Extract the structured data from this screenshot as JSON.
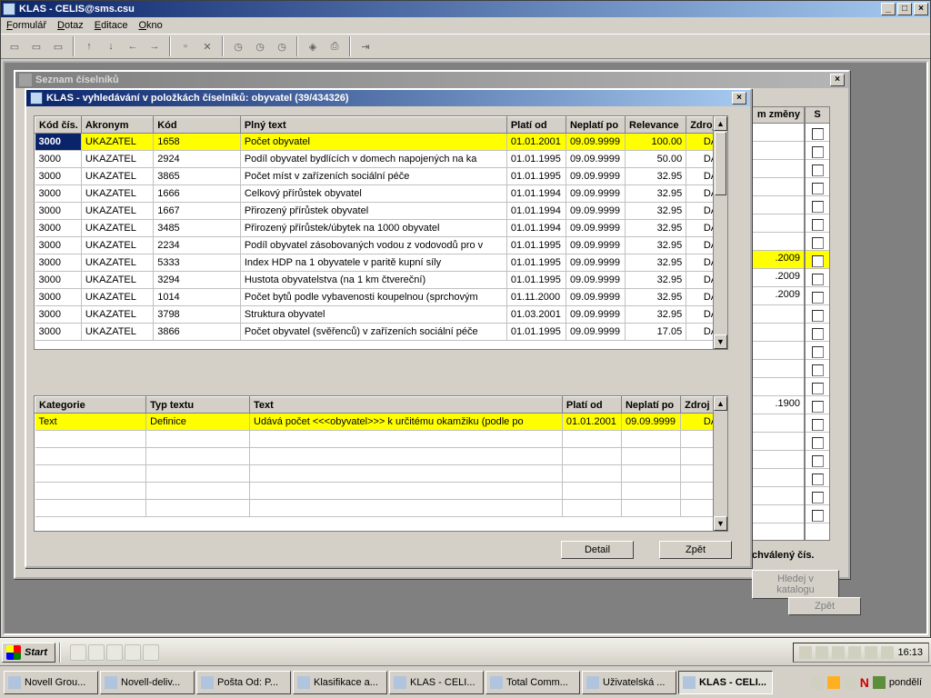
{
  "window": {
    "title": "KLAS - CELIS@sms.csu"
  },
  "menu": {
    "formular": "Formulář",
    "dotaz": "Dotaz",
    "editace": "Editace",
    "okno": "Okno"
  },
  "mdi": {
    "bg_window_title": "Seznam číselníků",
    "bg_header_date": "m změny",
    "bg_header_s": "S",
    "bg_dates": [
      "",
      "",
      "",
      "",
      "",
      "",
      "",
      ".2009",
      ".2009",
      ".2009",
      "",
      "",
      "",
      "",
      "",
      ".1900",
      "",
      "",
      "",
      "",
      "",
      ""
    ],
    "bg_sel_index": 7,
    "bg_footer_label": "chválený čís.",
    "bg_btn_catalog": "Hledej v katalogu",
    "bg_btn_back": "Zpět"
  },
  "search": {
    "title": "KLAS - vyhledávání v položkách číselníků: obyvatel  (39/434326)",
    "headers": {
      "kodcis": "Kód čís.",
      "akronym": "Akronym",
      "kod": "Kód",
      "plny": "Plný text",
      "platiod": "Platí od",
      "neplati": "Neplatí po",
      "relevance": "Relevance",
      "zdroj": "Zdroj"
    },
    "rows": [
      {
        "kodcis": "3000",
        "akronym": "UKAZATEL",
        "kod": "1658",
        "plny": "Počet obyvatel",
        "od": "01.01.2001",
        "do": "09.09.9999",
        "rel": "100.00",
        "zdroj": "DAT",
        "sel": true
      },
      {
        "kodcis": "3000",
        "akronym": "UKAZATEL",
        "kod": "2924",
        "plny": "Podíl obyvatel bydlících v domech napojených na ka",
        "od": "01.01.1995",
        "do": "09.09.9999",
        "rel": "50.00",
        "zdroj": "DAT"
      },
      {
        "kodcis": "3000",
        "akronym": "UKAZATEL",
        "kod": "3865",
        "plny": "Počet míst v zařízeních sociální péče",
        "od": "01.01.1995",
        "do": "09.09.9999",
        "rel": "32.95",
        "zdroj": "DAT"
      },
      {
        "kodcis": "3000",
        "akronym": "UKAZATEL",
        "kod": "1666",
        "plny": "Celkový přírůstek obyvatel",
        "od": "01.01.1994",
        "do": "09.09.9999",
        "rel": "32.95",
        "zdroj": "DAT"
      },
      {
        "kodcis": "3000",
        "akronym": "UKAZATEL",
        "kod": "1667",
        "plny": "Přirozený přírůstek obyvatel",
        "od": "01.01.1994",
        "do": "09.09.9999",
        "rel": "32.95",
        "zdroj": "DAT"
      },
      {
        "kodcis": "3000",
        "akronym": "UKAZATEL",
        "kod": "3485",
        "plny": "Přirozený přírůstek/úbytek na 1000 obyvatel",
        "od": "01.01.1994",
        "do": "09.09.9999",
        "rel": "32.95",
        "zdroj": "DAT"
      },
      {
        "kodcis": "3000",
        "akronym": "UKAZATEL",
        "kod": "2234",
        "plny": "Podíl obyvatel zásobovaných vodou z vodovodů pro v",
        "od": "01.01.1995",
        "do": "09.09.9999",
        "rel": "32.95",
        "zdroj": "DAT"
      },
      {
        "kodcis": "3000",
        "akronym": "UKAZATEL",
        "kod": "5333",
        "plny": "Index HDP na 1 obyvatele v paritě kupní síly",
        "od": "01.01.1995",
        "do": "09.09.9999",
        "rel": "32.95",
        "zdroj": "DAT"
      },
      {
        "kodcis": "3000",
        "akronym": "UKAZATEL",
        "kod": "3294",
        "plny": "Hustota obyvatelstva (na 1 km čtvereční)",
        "od": "01.01.1995",
        "do": "09.09.9999",
        "rel": "32.95",
        "zdroj": "DAT"
      },
      {
        "kodcis": "3000",
        "akronym": "UKAZATEL",
        "kod": "1014",
        "plny": "Počet bytů podle vybavenosti koupelnou (sprchovým",
        "od": "01.11.2000",
        "do": "09.09.9999",
        "rel": "32.95",
        "zdroj": "DAT"
      },
      {
        "kodcis": "3000",
        "akronym": "UKAZATEL",
        "kod": "3798",
        "plny": "Struktura obyvatel",
        "od": "01.03.2001",
        "do": "09.09.9999",
        "rel": "32.95",
        "zdroj": "DAT"
      },
      {
        "kodcis": "3000",
        "akronym": "UKAZATEL",
        "kod": "3866",
        "plny": "Počet obyvatel (svěřenců) v zařízeních sociální péče",
        "od": "01.01.1995",
        "do": "09.09.9999",
        "rel": "17.05",
        "zdroj": "DAT"
      }
    ],
    "detail_headers": {
      "kategorie": "Kategorie",
      "typ": "Typ textu",
      "text": "Text",
      "platiod": "Platí od",
      "neplati": "Neplatí po",
      "zdroj": "Zdroj"
    },
    "detail_rows": [
      {
        "kat": "Text",
        "typ": "Definice",
        "text": "Udává počet <<<obyvatel>>> k určitému okamžiku (podle po",
        "od": "01.01.2001",
        "do": "09.09.9999",
        "zdroj": "DAT",
        "sel": true
      }
    ],
    "btn_detail": "Detail",
    "btn_back": "Zpět"
  },
  "taskbar": {
    "start": "Start",
    "clock": "16:13",
    "day": "pondělí",
    "tasks": [
      {
        "label": "Novell Grou..."
      },
      {
        "label": "Novell-deliv..."
      },
      {
        "label": "Pošta Od: P..."
      },
      {
        "label": "Klasifikace a..."
      },
      {
        "label": "KLAS - CELI..."
      },
      {
        "label": "Total Comm..."
      },
      {
        "label": "Uživatelská ..."
      },
      {
        "label": "KLAS - CELI...",
        "active": true
      }
    ]
  }
}
